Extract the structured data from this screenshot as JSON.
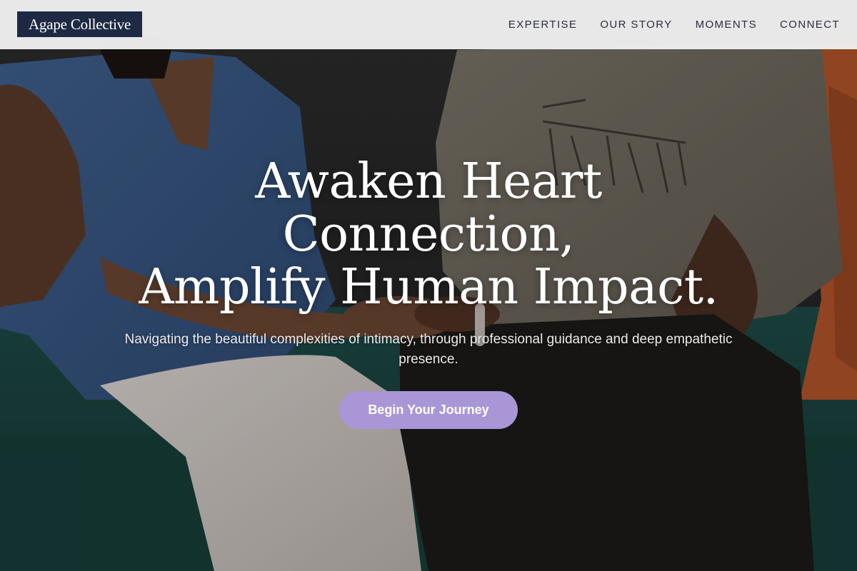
{
  "header": {
    "brand": "Agape Collective",
    "nav": [
      {
        "label": "EXPERTISE"
      },
      {
        "label": "OUR STORY"
      },
      {
        "label": "MOMENTS"
      },
      {
        "label": "CONNECT"
      }
    ]
  },
  "hero": {
    "title_lines": [
      "Awaken Heart",
      "Connection,",
      "Amplify Human Impact."
    ],
    "subtitle": "Navigating the beautiful complexities of intimacy, through professional guidance and deep empathetic presence.",
    "cta_label": "Begin Your Journey"
  },
  "colors": {
    "header_bg": "#f0f0f0",
    "brand_bg": "#1e2a44",
    "cta_bg": "#a996d6",
    "text_light": "#ffffff"
  }
}
